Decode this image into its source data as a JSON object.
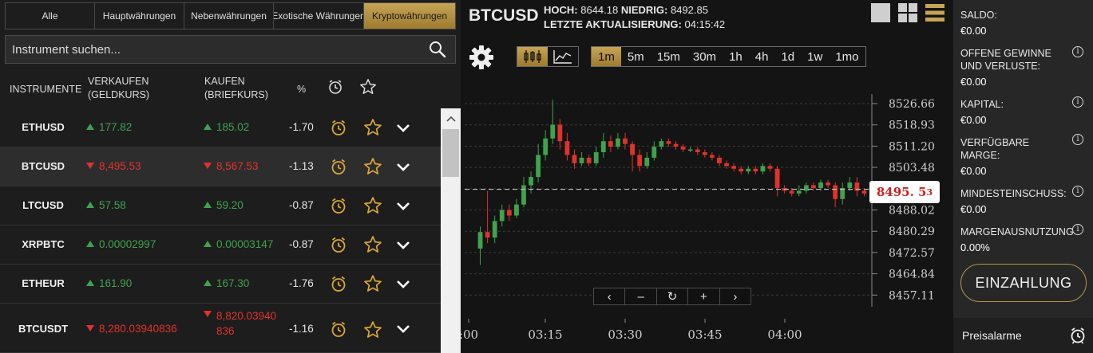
{
  "tabs": [
    {
      "label": "Alle",
      "active": false
    },
    {
      "label": "Hauptwährungen",
      "active": false
    },
    {
      "label": "Nebenwährungen",
      "active": false
    },
    {
      "label": "Exotische Währungen",
      "active": false
    },
    {
      "label": "Kryptowährungen",
      "active": true
    }
  ],
  "search": {
    "placeholder": "Instrument suchen..."
  },
  "table_headers": {
    "instruments": "INSTRUMENTE",
    "sell_1": "VERKAUFEN",
    "sell_2": "(GELDKURS)",
    "buy_1": "KAUFEN",
    "buy_2": "(BRIEFKURS)",
    "pct": "%"
  },
  "instruments": [
    {
      "symbol": "ETHUSD",
      "bid": "177.82",
      "bid_dir": "up",
      "ask": "185.02",
      "ask_dir": "up",
      "change": "-1.70",
      "selected": false
    },
    {
      "symbol": "BTCUSD",
      "bid": "8,495.53",
      "bid_dir": "down",
      "ask": "8,567.53",
      "ask_dir": "down",
      "change": "-1.13",
      "selected": true
    },
    {
      "symbol": "LTCUSD",
      "bid": "57.58",
      "bid_dir": "up",
      "ask": "59.20",
      "ask_dir": "up",
      "change": "-0.87",
      "selected": false
    },
    {
      "symbol": "XRPBTC",
      "bid": "0.00002997",
      "bid_dir": "up",
      "ask": "0.00003147",
      "ask_dir": "up",
      "change": "-0.87",
      "selected": false
    },
    {
      "symbol": "ETHEUR",
      "bid": "161.90",
      "bid_dir": "up",
      "ask": "167.30",
      "ask_dir": "up",
      "change": "-1.76",
      "selected": false
    },
    {
      "symbol": "BTCUSDT",
      "bid": "8,280.03940836",
      "bid_dir": "down",
      "ask_line1": "8,820.03940",
      "ask_line2": "836",
      "ask_dir": "down",
      "change": "-1.16",
      "selected": false
    }
  ],
  "chart_header": {
    "symbol": "BTCUSD",
    "high_label": "HOCH:",
    "high": "8644.18",
    "low_label": "NIEDRIG:",
    "low": "8492.85",
    "update_label": "LETZTE AKTUALISIERUNG:",
    "update_time": "04:15:42"
  },
  "intervals": [
    {
      "label": "1m",
      "active": true
    },
    {
      "label": "5m",
      "active": false
    },
    {
      "label": "15m",
      "active": false
    },
    {
      "label": "30m",
      "active": false
    },
    {
      "label": "1h",
      "active": false
    },
    {
      "label": "4h",
      "active": false
    },
    {
      "label": "1d",
      "active": false
    },
    {
      "label": "1w",
      "active": false
    },
    {
      "label": "1mo",
      "active": false
    }
  ],
  "price_tag": {
    "main": "8495. 5",
    "sup": "3"
  },
  "chart_data": {
    "type": "candlestick",
    "y_ticks": [
      "8526.66",
      "8518.93",
      "8511.20",
      "8503.48",
      "8495.75",
      "8488.02",
      "8480.29",
      "8472.57",
      "8464.84",
      "8457.11"
    ],
    "y_tick_values": [
      8526.66,
      8518.93,
      8511.2,
      8503.48,
      8495.75,
      8488.02,
      8480.29,
      8472.57,
      8464.84,
      8457.11
    ],
    "x_ticks": [
      ":00",
      "03:15",
      "03:30",
      "03:45",
      "04:00"
    ],
    "current_price": 8495.53,
    "candles": [
      [
        8474,
        8480,
        8468,
        8482
      ],
      [
        8480,
        8478,
        8476,
        8495
      ],
      [
        8478,
        8484,
        8476,
        8486
      ],
      [
        8484,
        8488,
        8482,
        8490
      ],
      [
        8488,
        8486,
        8484,
        8490
      ],
      [
        8486,
        8490,
        8485,
        8492
      ],
      [
        8490,
        8497,
        8489,
        8500
      ],
      [
        8497,
        8500,
        8494,
        8502
      ],
      [
        8500,
        8508,
        8498,
        8512
      ],
      [
        8508,
        8514,
        8506,
        8517
      ],
      [
        8514,
        8519,
        8512,
        8528
      ],
      [
        8519,
        8513,
        8510,
        8521
      ],
      [
        8513,
        8508,
        8506,
        8516
      ],
      [
        8508,
        8505,
        8503,
        8510
      ],
      [
        8505,
        8507,
        8504,
        8509
      ],
      [
        8507,
        8505,
        8504,
        8508
      ],
      [
        8505,
        8509,
        8504,
        8511
      ],
      [
        8509,
        8513,
        8507,
        8516
      ],
      [
        8513,
        8511,
        8509,
        8515
      ],
      [
        8511,
        8514,
        8510,
        8516
      ],
      [
        8514,
        8512,
        8510,
        8516
      ],
      [
        8512,
        8508,
        8502,
        8513
      ],
      [
        8508,
        8504,
        8502,
        8510
      ],
      [
        8504,
        8507,
        8503,
        8509
      ],
      [
        8507,
        8511,
        8506,
        8513
      ],
      [
        8511,
        8513,
        8510,
        8514
      ],
      [
        8513,
        8512,
        8511,
        8514
      ],
      [
        8512,
        8511,
        8510,
        8513
      ],
      [
        8511,
        8510,
        8509,
        8512
      ],
      [
        8510,
        8510,
        8509,
        8511
      ],
      [
        8510,
        8509,
        8508,
        8511
      ],
      [
        8509,
        8508,
        8507,
        8510
      ],
      [
        8508,
        8507,
        8506,
        8509
      ],
      [
        8507,
        8505,
        8504,
        8508
      ],
      [
        8505,
        8504,
        8503,
        8506
      ],
      [
        8504,
        8503,
        8502,
        8505
      ],
      [
        8503,
        8502,
        8501,
        8504
      ],
      [
        8502,
        8503,
        8501,
        8504
      ],
      [
        8503,
        8502,
        8501,
        8504
      ],
      [
        8502,
        8504,
        8501,
        8505
      ],
      [
        8504,
        8503,
        8502,
        8505
      ],
      [
        8503,
        8496,
        8493,
        8504
      ],
      [
        8496,
        8495,
        8494,
        8497
      ],
      [
        8495,
        8494,
        8493,
        8496
      ],
      [
        8494,
        8495,
        8493,
        8497
      ],
      [
        8495,
        8497,
        8494,
        8498
      ],
      [
        8497,
        8496,
        8495,
        8498
      ],
      [
        8496,
        8498,
        8495,
        8499
      ],
      [
        8498,
        8497,
        8496,
        8499
      ],
      [
        8497,
        8492,
        8489,
        8498
      ],
      [
        8492,
        8496,
        8490,
        8498
      ],
      [
        8496,
        8498,
        8495,
        8500
      ],
      [
        8498,
        8495,
        8493,
        8500
      ],
      [
        8495,
        8494,
        8493,
        8496
      ]
    ]
  },
  "nav_buttons": [
    "‹",
    "–",
    "↻",
    "+",
    "›"
  ],
  "account": {
    "balance_label": "SALDO:",
    "balance": "€0.00",
    "pnl_label_1": "OFFENE GEWINNE",
    "pnl_label_2": "UND VERLUSTE:",
    "pnl": "€0.00",
    "capital_label": "KAPITAL:",
    "capital": "€0.00",
    "free_margin_label_1": "VERFÜGBARE",
    "free_margin_label_2": "MARGE:",
    "free_margin": "€0.00",
    "min_margin_label": "MINDESTEINSCHUSS:",
    "min_margin": "€0.00",
    "margin_usage_label": "MARGENAUSNUTZUNG",
    "margin_usage": "0.00%",
    "deposit_label": "EINZAHLUNG",
    "alerts_label": "Preisalarme"
  },
  "colors": {
    "up": "#3fa34d",
    "down": "#e0322d",
    "gold": "#b89548"
  }
}
